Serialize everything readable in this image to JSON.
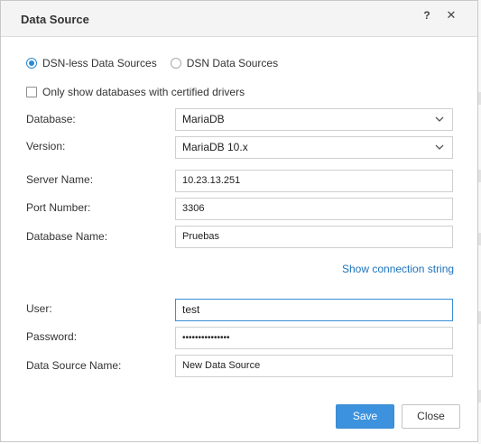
{
  "dialog": {
    "title": "Data Source",
    "help_glyph": "?",
    "close_glyph": "✕"
  },
  "source_type": {
    "options": [
      {
        "label": "DSN-less Data Sources",
        "selected": true
      },
      {
        "label": "DSN Data Sources",
        "selected": false
      }
    ]
  },
  "certified_only": {
    "label": "Only show databases with certified drivers",
    "checked": false
  },
  "fields": {
    "database": {
      "label": "Database:",
      "value": "MariaDB"
    },
    "version": {
      "label": "Version:",
      "value": "MariaDB 10.x"
    },
    "server_name": {
      "label": "Server Name:",
      "value": "10.23.13.251"
    },
    "port_number": {
      "label": "Port Number:",
      "value": "3306"
    },
    "database_name": {
      "label": "Database Name:",
      "value": "Pruebas"
    },
    "user": {
      "label": "User:",
      "value": "test"
    },
    "password": {
      "label": "Password:",
      "value": "•••••••••••••••"
    },
    "data_source_name": {
      "label": "Data Source Name:",
      "value": "New Data Source"
    }
  },
  "show_connection_string": "Show connection string",
  "buttons": {
    "save": "Save",
    "close": "Close"
  },
  "colors": {
    "accent": "#3d92dd",
    "link": "#1d73bd",
    "focus": "#3a8fd6"
  }
}
